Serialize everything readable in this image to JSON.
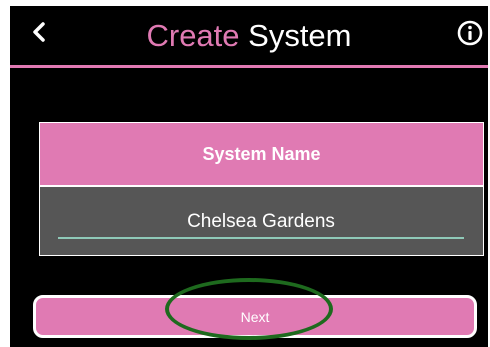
{
  "header": {
    "back_icon": "chevron-left-icon",
    "title_accent": "Create",
    "title_rest": " System",
    "info_icon": "info-icon"
  },
  "form": {
    "section_label": "System Name",
    "system_name_value": "Chelsea Gardens"
  },
  "actions": {
    "next_label": "Next"
  },
  "colors": {
    "accent": "#e07ab3",
    "background": "#000000",
    "input_panel": "#565656",
    "input_underline": "#8fc9b8",
    "highlight_ring": "#1e6a1e"
  }
}
